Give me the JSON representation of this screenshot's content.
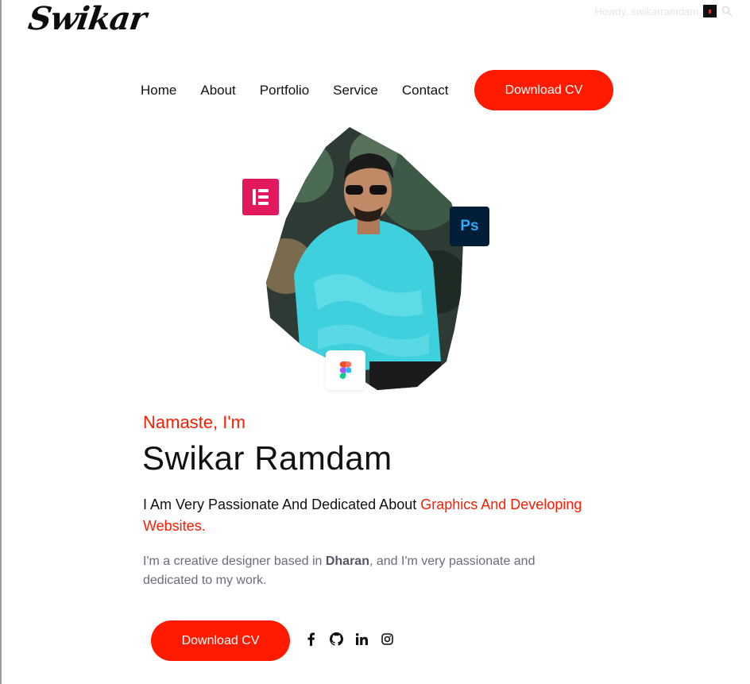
{
  "brand": {
    "logo_text": "Swikar"
  },
  "adminbar": {
    "howdy": "Howdy, swikarramdam",
    "search_icon": "search-icon"
  },
  "nav": {
    "items": [
      {
        "label": "Home"
      },
      {
        "label": "About"
      },
      {
        "label": "Portfolio"
      },
      {
        "label": "Service"
      },
      {
        "label": "Contact"
      }
    ],
    "cta_label": "Download CV"
  },
  "hero": {
    "badges": [
      {
        "icon": "elementor-icon",
        "color": "#e2195c"
      },
      {
        "icon": "photoshop-icon",
        "text": "Ps",
        "color": "#001e36"
      },
      {
        "icon": "figma-icon",
        "color": "#ffffff"
      }
    ],
    "greeting": "Namaste, I'm",
    "name": "Swikar Ramdam",
    "tagline_start": "I Am Very Passionate And Dedicated About ",
    "tagline_highlight": "Graphics And Developing Websites.",
    "bio_start": "I'm a creative designer based in ",
    "bio_city": "Dharan",
    "bio_end": ", and I'm very passionate and dedicated to my work.",
    "cta_label": "Download CV",
    "socials": [
      {
        "icon": "facebook-icon"
      },
      {
        "icon": "github-icon"
      },
      {
        "icon": "linkedin-icon"
      },
      {
        "icon": "instagram-icon"
      }
    ]
  },
  "colors": {
    "accent": "#ff1a00",
    "text": "#111111",
    "muted": "#6b6b7e"
  }
}
